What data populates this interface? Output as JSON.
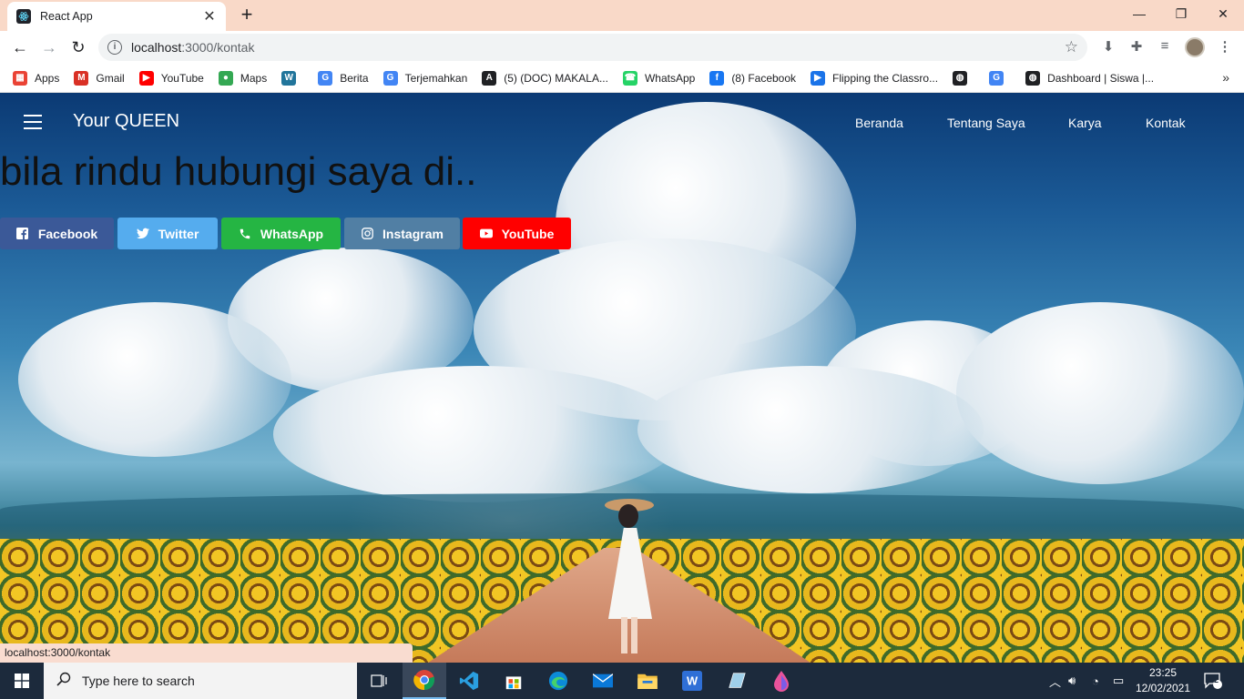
{
  "browser": {
    "tab_title": "React App",
    "url_host": "localhost",
    "url_path": ":3000/kontak",
    "bookmarks": [
      {
        "label": "Apps",
        "icon": "apps-grid-icon",
        "color": "#ea4335"
      },
      {
        "label": "Gmail",
        "icon": "gmail-icon",
        "color": "#d93025"
      },
      {
        "label": "YouTube",
        "icon": "youtube-icon",
        "color": "#ff0000"
      },
      {
        "label": "Maps",
        "icon": "maps-icon",
        "color": "#34a853"
      },
      {
        "label": "",
        "icon": "wordpress-icon",
        "color": "#21759b"
      },
      {
        "label": "Berita",
        "icon": "google-news-icon",
        "color": "#4285f4"
      },
      {
        "label": "Terjemahkan",
        "icon": "google-translate-icon",
        "color": "#4285f4"
      },
      {
        "label": "(5) (DOC) MAKALA...",
        "icon": "academia-icon",
        "color": "#202124"
      },
      {
        "label": "WhatsApp",
        "icon": "whatsapp-icon",
        "color": "#25d366"
      },
      {
        "label": "(8) Facebook",
        "icon": "facebook-icon",
        "color": "#1877f2"
      },
      {
        "label": "Flipping the Classro...",
        "icon": "video-play-icon",
        "color": "#1a73e8"
      },
      {
        "label": "",
        "icon": "globe-icon",
        "color": "#202124"
      },
      {
        "label": "",
        "icon": "google-icon",
        "color": "#4285f4"
      },
      {
        "label": "Dashboard | Siswa |...",
        "icon": "globe-icon",
        "color": "#202124"
      }
    ],
    "status_url": "localhost:3000/kontak"
  },
  "site": {
    "brand": "Your QUEEN",
    "nav": [
      "Beranda",
      "Tentang Saya",
      "Karya",
      "Kontak"
    ],
    "heading": "bila rindu hubungi saya di..",
    "social_buttons": [
      {
        "label": "Facebook",
        "icon": "facebook-icon",
        "color": "#3b5998"
      },
      {
        "label": "Twitter",
        "icon": "twitter-icon",
        "color": "#55acee"
      },
      {
        "label": "WhatsApp",
        "icon": "phone-icon",
        "color": "#25b543"
      },
      {
        "label": "Instagram",
        "icon": "instagram-icon",
        "color": "#517fa4"
      },
      {
        "label": "YouTube",
        "icon": "youtube-icon",
        "color": "#ff0000"
      }
    ]
  },
  "taskbar": {
    "search_placeholder": "Type here to search",
    "time": "23:25",
    "date": "12/02/2021",
    "notification_count": "2"
  }
}
